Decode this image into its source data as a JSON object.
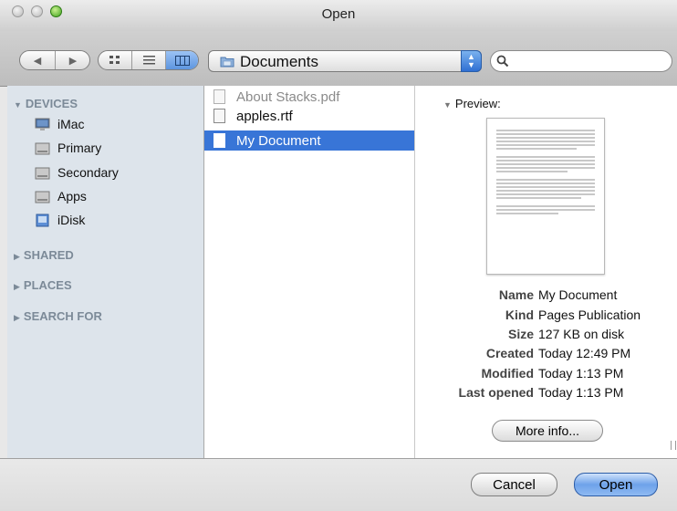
{
  "window": {
    "title": "Open"
  },
  "toolbar": {
    "back_icon": "chevron-left-icon",
    "forward_icon": "chevron-right-icon",
    "view_icons": [
      "icon-view-icon",
      "list-view-icon",
      "column-view-icon"
    ],
    "location": "Documents",
    "search_value": ""
  },
  "sidebar": {
    "devices_label": "DEVICES",
    "devices": [
      {
        "label": "iMac",
        "icon": "imac-icon"
      },
      {
        "label": "Primary",
        "icon": "hard-drive-icon"
      },
      {
        "label": "Secondary",
        "icon": "hard-drive-icon"
      },
      {
        "label": "Apps",
        "icon": "hard-drive-icon"
      },
      {
        "label": "iDisk",
        "icon": "idisk-icon"
      }
    ],
    "shared_label": "SHARED",
    "places_label": "PLACES",
    "search_label": "SEARCH FOR"
  },
  "files": [
    {
      "name": "About Stacks.pdf",
      "enabled": false
    },
    {
      "name": "apples.rtf",
      "enabled": true
    },
    {
      "name": "My Document",
      "enabled": true,
      "selected": true
    }
  ],
  "preview": {
    "label": "Preview:",
    "info": [
      {
        "label": "Name",
        "value": "My Document"
      },
      {
        "label": "Kind",
        "value": "Pages Publication"
      },
      {
        "label": "Size",
        "value": "127 KB on disk"
      },
      {
        "label": "Created",
        "value": "Today 12:49 PM"
      },
      {
        "label": "Modified",
        "value": "Today 1:13 PM"
      },
      {
        "label": "Last opened",
        "value": "Today 1:13 PM"
      }
    ],
    "more_info": "More info..."
  },
  "buttons": {
    "cancel": "Cancel",
    "open": "Open"
  }
}
